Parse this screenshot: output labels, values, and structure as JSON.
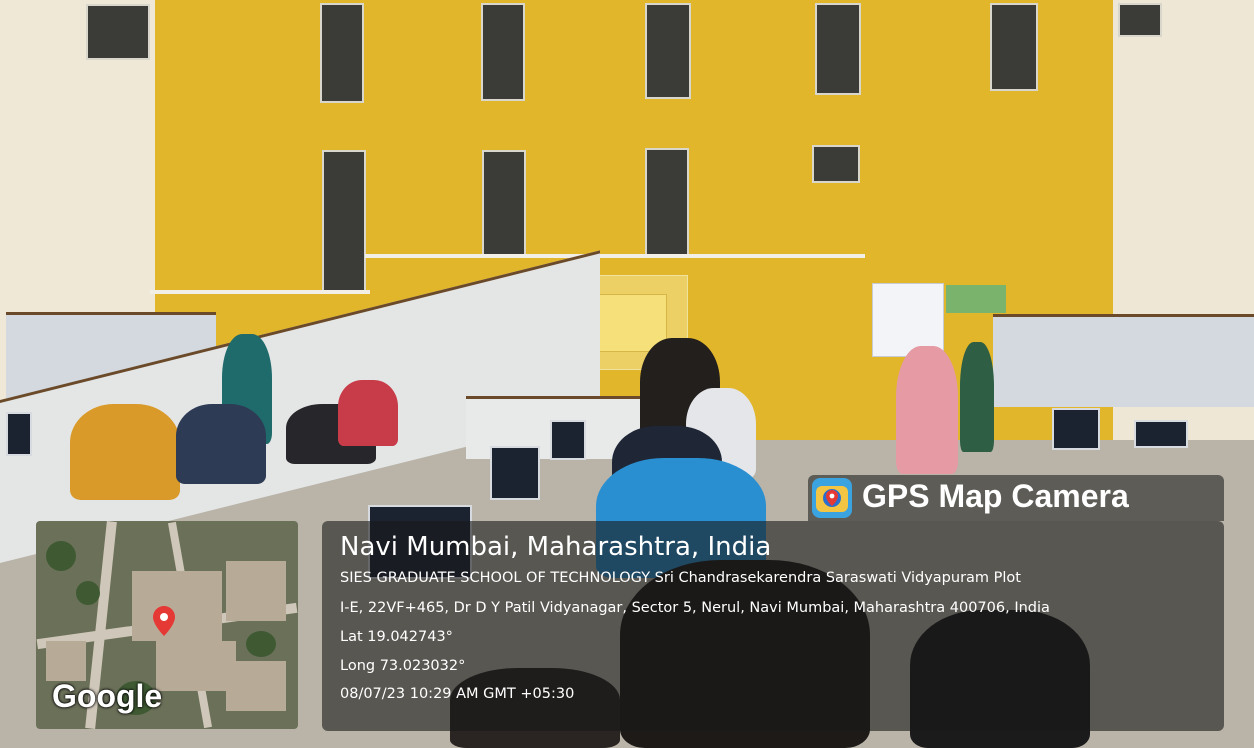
{
  "overlay": {
    "app_name": "GPS Map Camera",
    "map_brand": "Google",
    "city_line": "Navi Mumbai, Maharashtra, India",
    "address_line_1": "SIES GRADUATE SCHOOL OF TECHNOLOGY Sri Chandrasekarendra Saraswati Vidyapuram Plot",
    "address_line_2": "I-E, 22VF+465, Dr D Y Patil Vidyanagar, Sector 5, Nerul, Navi Mumbai, Maharashtra 400706, India",
    "latitude": "Lat 19.042743°",
    "longitude": "Long 73.023032°",
    "timestamp": "08/07/23 10:29 AM GMT +05:30"
  },
  "icons": {
    "app_icon": "gps-map-camera-icon",
    "pin_icon": "map-pin-icon"
  },
  "colors": {
    "wall": "#e2b62a",
    "pin": "#e53935",
    "panel_bg": "rgba(25,25,25,0.6)"
  }
}
